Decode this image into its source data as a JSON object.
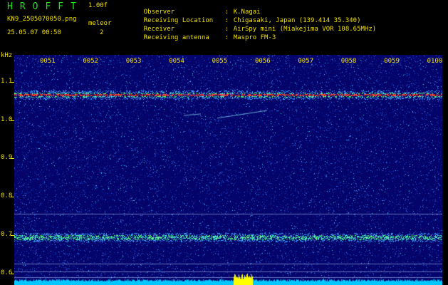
{
  "header": {
    "app_title": "HROFFT",
    "version": "1.00f",
    "filename": "KN9_2505070050.png",
    "mode_label": "meleor",
    "mode_value": "2",
    "datetime": "25.05.07 00:50"
  },
  "info": [
    {
      "key": "Observer",
      "sep": ":",
      "value": "K.Nagai"
    },
    {
      "key": "Receiving Location",
      "sep": ":",
      "value": "Chigasaki, Japan (139.414 35.340)"
    },
    {
      "key": "Receiver",
      "sep": ":",
      "value": "AirSpy mini (Miakejima VOR 108.65MHz)"
    },
    {
      "key": "Receiving antenna",
      "sep": ":",
      "value": "Maspro FM-3"
    }
  ],
  "chart_data": {
    "type": "heatmap",
    "x_ticks": [
      "0051",
      "0052",
      "0053",
      "0054",
      "0055",
      "0056",
      "0057",
      "0058",
      "0059",
      "0100"
    ],
    "y_unit": "kHz",
    "y_ticks": [
      "1.1",
      "1.0",
      "0.9",
      "0.8",
      "0.7",
      "0.6"
    ],
    "y_values": [
      1.1,
      1.0,
      0.9,
      0.8,
      0.7,
      0.6
    ],
    "ylim": [
      0.57,
      1.17
    ],
    "carrier_lines_khz": [
      1.065,
      0.693
    ],
    "faint_lines_khz": [
      0.755,
      0.625,
      0.605,
      0.59
    ],
    "colors": {
      "background": "#04046a",
      "carrier": "#ff5030",
      "text": "#f0e000",
      "title": "#18e818",
      "signal_bar": "#ffff00",
      "noise_bar": "#00c8ff"
    }
  }
}
